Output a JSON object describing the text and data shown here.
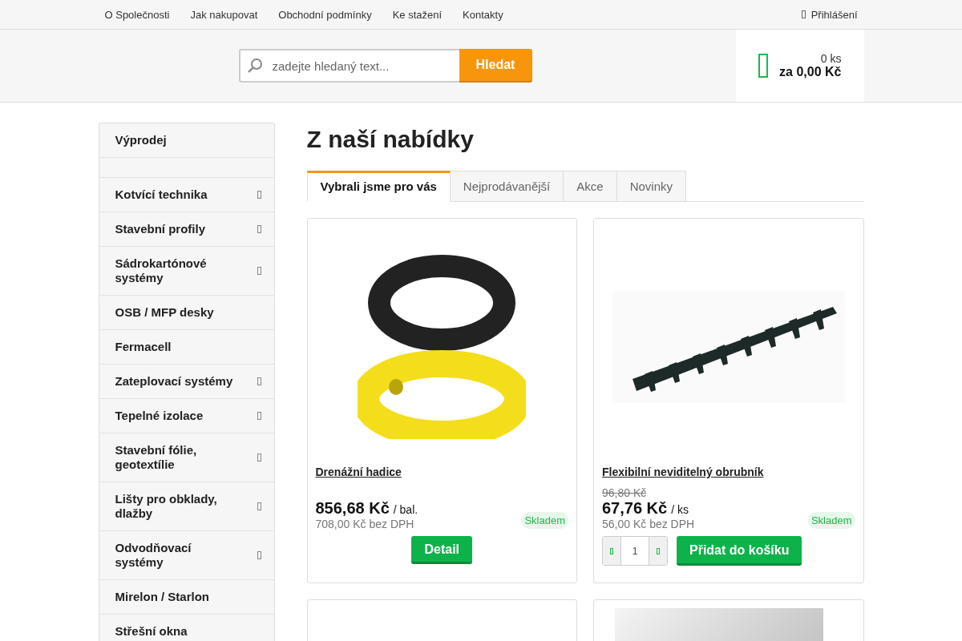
{
  "top_nav": {
    "links": [
      "O Společnosti",
      "Jak nakupovat",
      "Obchodní podmínky",
      "Ke stažení",
      "Kontakty"
    ],
    "login": "Přihlášení"
  },
  "search": {
    "placeholder": "zadejte hledaný text...",
    "button": "Hledat"
  },
  "cart": {
    "count": "0 ks",
    "total": "za 0,00 Kč"
  },
  "sidebar": {
    "items": [
      {
        "label": "Výprodej",
        "has_submenu": false
      },
      {
        "has_submenu": false
      },
      {
        "label": "Kotvící technika",
        "has_submenu": true
      },
      {
        "label": "Stavební profily",
        "has_submenu": true
      },
      {
        "label": "Sádrokartónové systémy",
        "has_submenu": true
      },
      {
        "label": "OSB / MFP desky",
        "has_submenu": false
      },
      {
        "label": "Fermacell",
        "has_submenu": false
      },
      {
        "label": "Zateplovací systémy",
        "has_submenu": true
      },
      {
        "label": "Tepelné izolace",
        "has_submenu": true
      },
      {
        "label": "Stavební fólie, geotextílie",
        "has_submenu": true
      },
      {
        "label": "Lišty pro obklady, dlažby",
        "has_submenu": true
      },
      {
        "label": "Odvodňovací systémy",
        "has_submenu": true
      },
      {
        "label": "Mirelon / Starlon",
        "has_submenu": false
      },
      {
        "label": "Střešní okna",
        "has_submenu": false
      }
    ]
  },
  "heading": "Z naší nabídky",
  "tabs": [
    {
      "label": "Vybrali jsme pro vás",
      "selected": true
    },
    {
      "label": "Nejprodávanější",
      "selected": false
    },
    {
      "label": "Akce",
      "selected": false
    },
    {
      "label": "Novinky",
      "selected": false
    }
  ],
  "products": [
    {
      "kind": "detail",
      "name": "Drenážní hadice",
      "price": "856,68 Kč",
      "unit": "/ bal.",
      "price_no_vat": "708,00 Kč bez DPH",
      "stock": "Skladem",
      "button": "Detail"
    },
    {
      "kind": "cart",
      "name": "Flexibilní neviditelný obrubník",
      "old_price": "96,80 Kč",
      "price": "67,76 Kč",
      "unit": "/ ks",
      "price_no_vat": "56,00 Kč bez DPH",
      "stock": "Skladem",
      "quantity": "1",
      "button": "Přidat do košíku"
    },
    {
      "kind": "partial"
    },
    {
      "kind": "partial"
    }
  ]
}
